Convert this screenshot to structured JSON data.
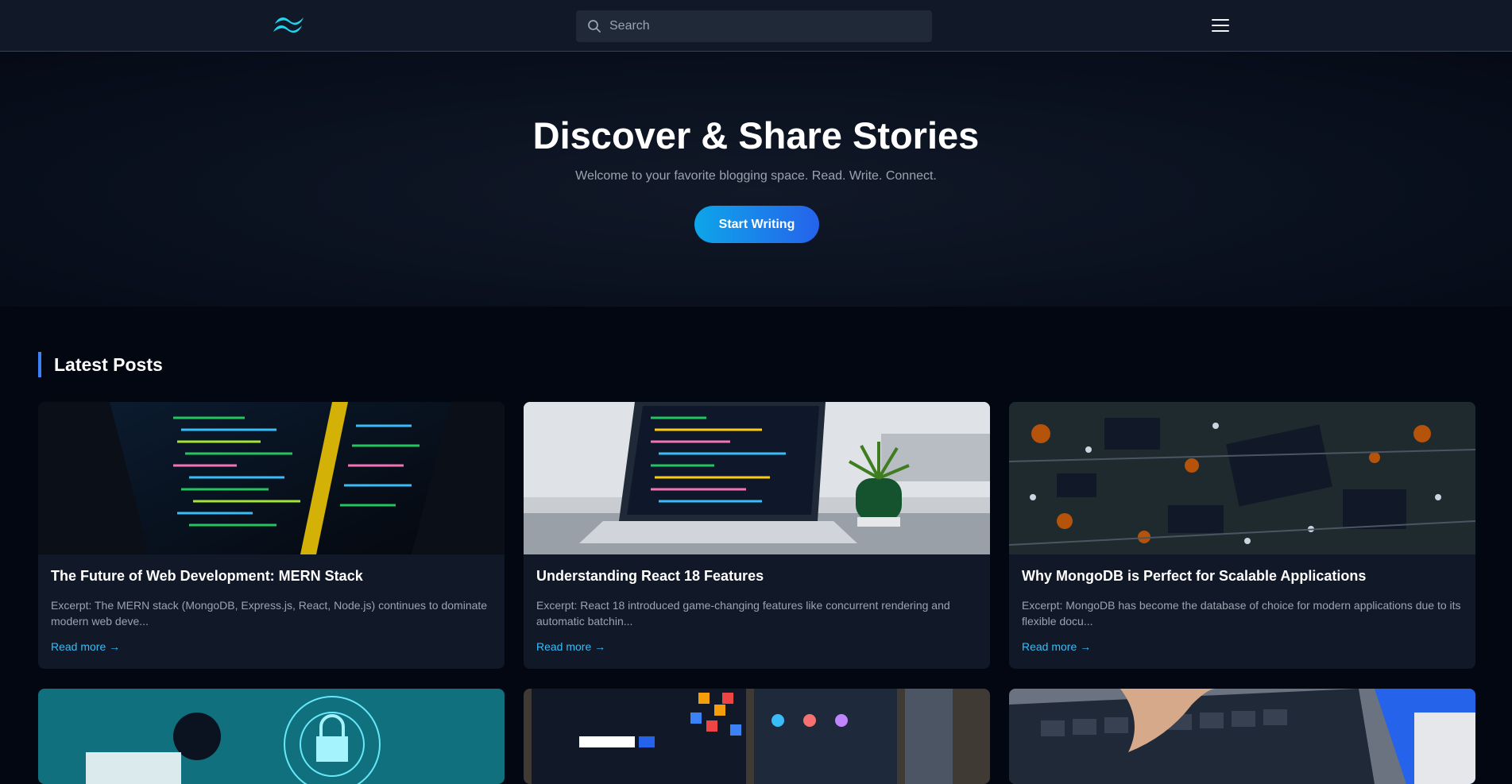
{
  "navbar": {
    "logo_icon": "tailwind-logo-icon",
    "search_placeholder": "Search",
    "menu_icon": "hamburger-menu-icon"
  },
  "hero": {
    "title": "Discover & Share Stories",
    "subtitle": "Welcome to your favorite blogging space. Read. Write. Connect.",
    "cta_label": "Start Writing"
  },
  "section": {
    "title": "Latest Posts"
  },
  "posts": [
    {
      "title": "The Future of Web Development: MERN Stack",
      "excerpt": "Excerpt: The MERN stack (MongoDB, Express.js, React, Node.js) continues to dominate modern web deve...",
      "read_more": "Read more →",
      "image": "code-on-laptop-screen"
    },
    {
      "title": "Understanding React 18 Features",
      "excerpt": "Excerpt: React 18 introduced game-changing features like concurrent rendering and automatic batchin...",
      "read_more": "Read more →",
      "image": "laptop-with-plant"
    },
    {
      "title": "Why MongoDB is Perfect for Scalable Applications",
      "excerpt": "Excerpt: MongoDB has become the database of choice for modern applications due to its flexible docu...",
      "read_more": "Read more →",
      "image": "circuit-board"
    },
    {
      "image": "cybersecurity-lock"
    },
    {
      "image": "microsoft-courses-screens"
    },
    {
      "image": "hands-typing-on-laptop"
    }
  ],
  "colors": {
    "accent": "#3b82f6",
    "link": "#38bdf8",
    "background": "#030712",
    "card": "#111827"
  }
}
